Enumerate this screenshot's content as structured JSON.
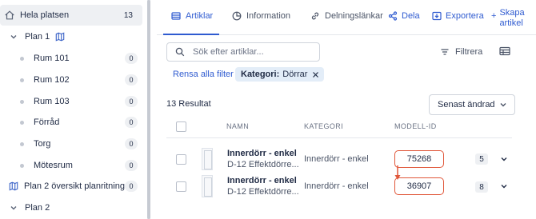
{
  "sidebar": {
    "top": {
      "label": "Hela platsen",
      "count": "13"
    },
    "plan1": {
      "label": "Plan 1"
    },
    "rooms": [
      {
        "label": "Rum 101",
        "count": "0"
      },
      {
        "label": "Rum 102",
        "count": "0"
      },
      {
        "label": "Rum 103",
        "count": "0"
      },
      {
        "label": "Förråd",
        "count": "0"
      },
      {
        "label": "Torg",
        "count": "0"
      },
      {
        "label": "Mötesrum",
        "count": "0"
      }
    ],
    "plan2_overview": {
      "label": "Plan 2 översikt planritning...",
      "count": "0"
    },
    "plan2": {
      "label": "Plan 2"
    }
  },
  "tabs": [
    {
      "label": "Artiklar",
      "icon": "table-icon"
    },
    {
      "label": "Information",
      "icon": "pie-chart-icon"
    },
    {
      "label": "Delningslänkar",
      "icon": "link-icon"
    }
  ],
  "actions": {
    "share": "Dela",
    "export": "Exportera",
    "create_line1": "Skapa",
    "create_line2": "artikel"
  },
  "search": {
    "placeholder": "Sök efter artiklar..."
  },
  "filter_label": "Filtrera",
  "clear_filters": "Rensa alla filter",
  "chip": {
    "key": "Kategori:",
    "value": "Dörrar"
  },
  "results": "13 Resultat",
  "sort": {
    "selected": "Senast ändrad"
  },
  "columns": {
    "name": "NAMN",
    "category": "KATEGORI",
    "model_id": "MODELL-ID"
  },
  "rows": [
    {
      "name": "Innerdörr - enkel",
      "sub": "D-12 Effektdörre...",
      "category": "Innerdörr - enkel",
      "model_id": "75268",
      "qty": "5"
    },
    {
      "name": "Innerdörr - enkel",
      "sub": "D-12 Effektdörre...",
      "category": "Innerdörr - enkel",
      "model_id": "36907",
      "qty": "8"
    }
  ],
  "colors": {
    "accent": "#2f5bd0",
    "highlight": "#e0573a"
  }
}
